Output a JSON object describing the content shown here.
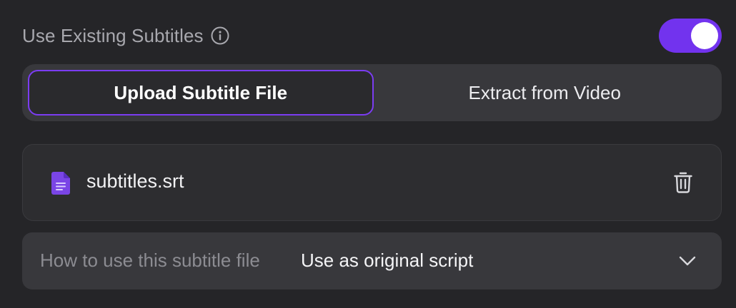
{
  "header": {
    "title": "Use Existing Subtitles",
    "info_icon": "info-circle-icon",
    "toggle_on": true,
    "toggle_color": "#7233ee"
  },
  "mode_selector": {
    "options": [
      {
        "label": "Upload Subtitle File",
        "active": true
      },
      {
        "label": "Extract from Video",
        "active": false
      }
    ],
    "active_border_color": "#7b3cf2"
  },
  "file_card": {
    "file_name": "subtitles.srt",
    "file_icon": "document-icon",
    "file_icon_color": "#7a45e6",
    "delete_icon": "trash-icon"
  },
  "usage_select": {
    "label": "How to use this subtitle file",
    "value": "Use as original script",
    "dropdown_icon": "chevron-down-icon"
  }
}
